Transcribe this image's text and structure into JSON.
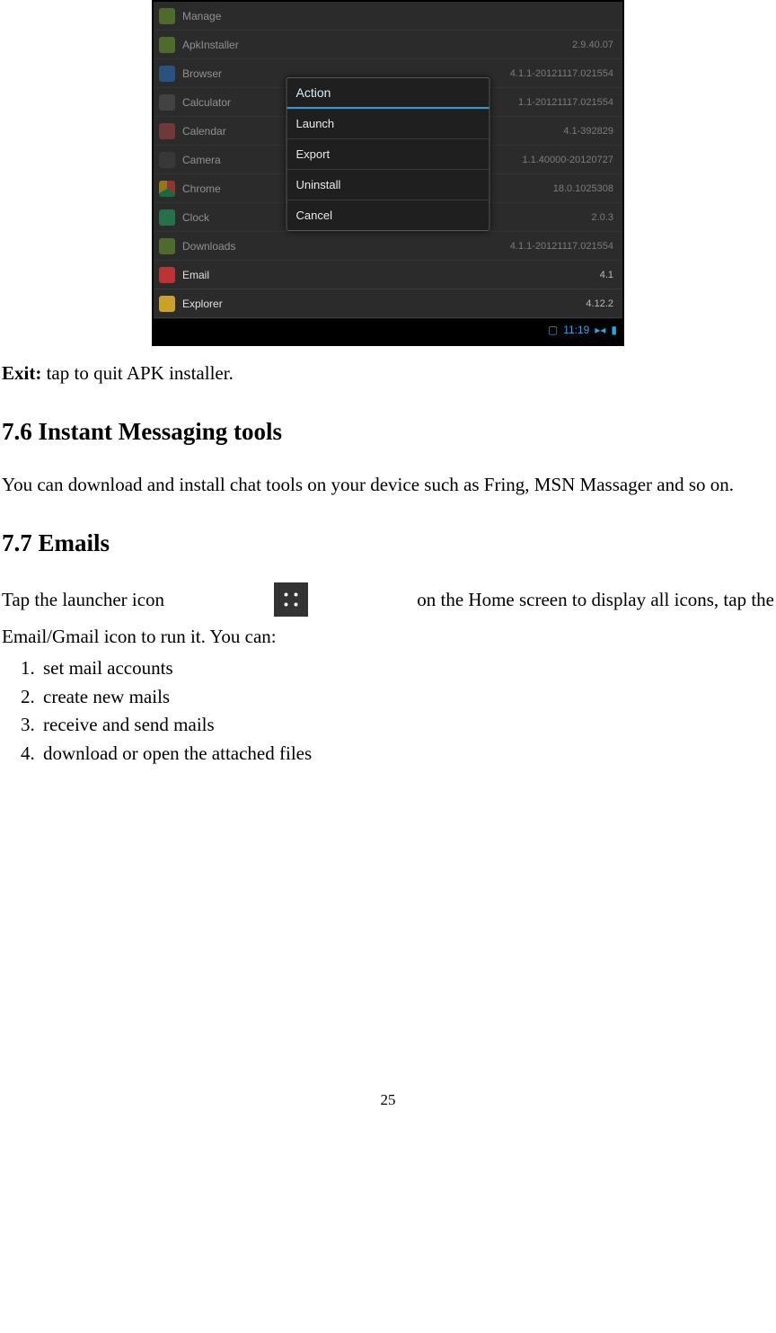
{
  "screenshot": {
    "apps": [
      {
        "name": "Manage",
        "version": "",
        "iconClass": "ic-manage",
        "dim": true
      },
      {
        "name": "ApkInstaller",
        "version": "2.9.40.07",
        "iconClass": "ic-apk",
        "dim": true
      },
      {
        "name": "Browser",
        "version": "4.1.1-20121117.021554",
        "iconClass": "ic-browser",
        "dim": true
      },
      {
        "name": "Calculator",
        "version": "1.1-20121117.021554",
        "iconClass": "ic-calc",
        "dim": true
      },
      {
        "name": "Calendar",
        "version": "4.1-392829",
        "iconClass": "ic-calendar",
        "dim": true
      },
      {
        "name": "Camera",
        "version": "1.1.40000-20120727",
        "iconClass": "ic-camera",
        "dim": true
      },
      {
        "name": "Chrome",
        "version": "18.0.1025308",
        "iconClass": "ic-chrome",
        "dim": true
      },
      {
        "name": "Clock",
        "version": "2.0.3",
        "iconClass": "ic-clock",
        "dim": true
      },
      {
        "name": "Downloads",
        "version": "4.1.1-20121117.021554",
        "iconClass": "ic-down",
        "dim": true
      },
      {
        "name": "Email",
        "version": "4.1",
        "iconClass": "ic-email",
        "dim": false
      },
      {
        "name": "Explorer",
        "version": "4.12.2",
        "iconClass": "ic-explorer",
        "dim": false
      }
    ],
    "dialog": {
      "title": "Action",
      "items": [
        "Launch",
        "Export",
        "Uninstall",
        "Cancel"
      ]
    },
    "status": {
      "time": "11:19"
    }
  },
  "exit": {
    "label": "Exit:",
    "text": " tap to quit APK installer."
  },
  "section76": {
    "heading": "7.6 Instant Messaging tools",
    "text": "You can download and install chat tools on your device such as Fring, MSN Massager and so on."
  },
  "section77": {
    "heading": "7.7 Emails",
    "line1_before": "Tap  the  launcher  icon",
    "line1_after_a": "on  the  Home  screen  to  display  all  icons,  tap  the",
    "line2": "Email/Gmail icon to run it. You can:",
    "list": [
      "set mail accounts",
      "create new mails",
      "receive and send mails",
      "download or open the attached files"
    ]
  },
  "pageNumber": "25"
}
